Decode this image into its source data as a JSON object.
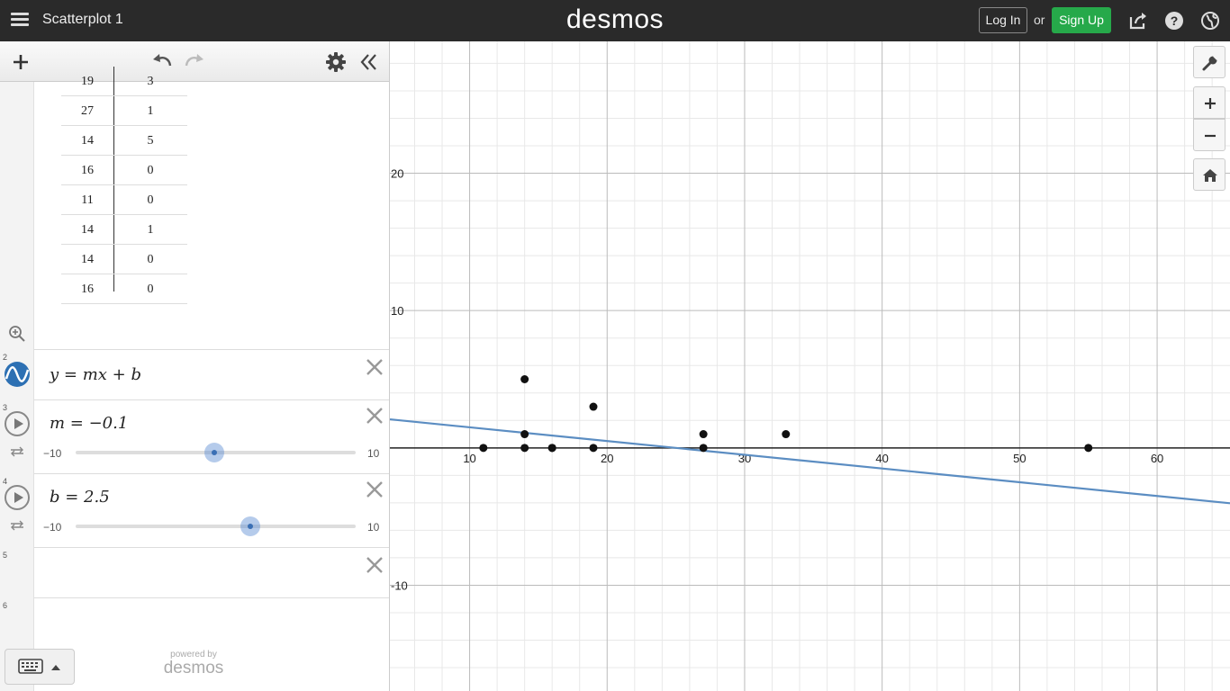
{
  "header": {
    "graph_title": "Scatterplot 1",
    "logo": "desmos",
    "login_label": "Log In",
    "or_label": "or",
    "signup_label": "Sign Up",
    "icons": [
      "menu-icon",
      "share-icon",
      "help-icon",
      "globe-icon"
    ],
    "accent_color": "#26a94a",
    "bg_color": "#2a2a2a"
  },
  "toolbar": {
    "icons": [
      "add-icon",
      "undo-icon",
      "redo-icon",
      "settings-icon",
      "collapse-icon"
    ]
  },
  "table": {
    "rows": [
      [
        "19",
        "3"
      ],
      [
        "27",
        "1"
      ],
      [
        "14",
        "5"
      ],
      [
        "16",
        "0"
      ],
      [
        "11",
        "0"
      ],
      [
        "14",
        "1"
      ],
      [
        "14",
        "0"
      ],
      [
        "16",
        "0"
      ]
    ]
  },
  "expressions": [
    {
      "num": "2",
      "text": "y = mx + b",
      "icon": "regression-icon"
    },
    {
      "num": "3",
      "text": "m = −0.1",
      "slider_min": "−10",
      "slider_max": "10",
      "value": -0.1,
      "min": -10,
      "max": 10
    },
    {
      "num": "4",
      "text": "b = 2.5",
      "slider_min": "−10",
      "slider_max": "10",
      "value": 2.5,
      "min": -10,
      "max": 10
    },
    {
      "num": "5",
      "text": ""
    },
    {
      "num": "6",
      "text": ""
    }
  ],
  "footer": {
    "powered_by": "powered by",
    "brand": "desmos"
  },
  "graph": {
    "x_ticks": [
      "10",
      "20",
      "30",
      "40",
      "50",
      "60"
    ],
    "y_ticks": [
      "20",
      "10",
      "-10"
    ],
    "xlim": [
      4.2,
      65.3
    ],
    "ylim": [
      -17.7,
      29.6
    ],
    "line_color": "#5b8dc2",
    "point_color": "#111111",
    "points": [
      [
        11,
        0
      ],
      [
        14,
        0
      ],
      [
        14,
        1
      ],
      [
        14,
        5
      ],
      [
        16,
        0
      ],
      [
        16,
        0
      ],
      [
        19,
        0
      ],
      [
        19,
        3
      ],
      [
        27,
        0
      ],
      [
        27,
        1
      ],
      [
        33,
        1
      ],
      [
        55,
        0
      ]
    ],
    "line": {
      "m": -0.1,
      "b": 2.5
    },
    "side_icons": [
      "wrench-icon",
      "zoom-in-icon",
      "zoom-out-icon",
      "home-icon"
    ]
  }
}
